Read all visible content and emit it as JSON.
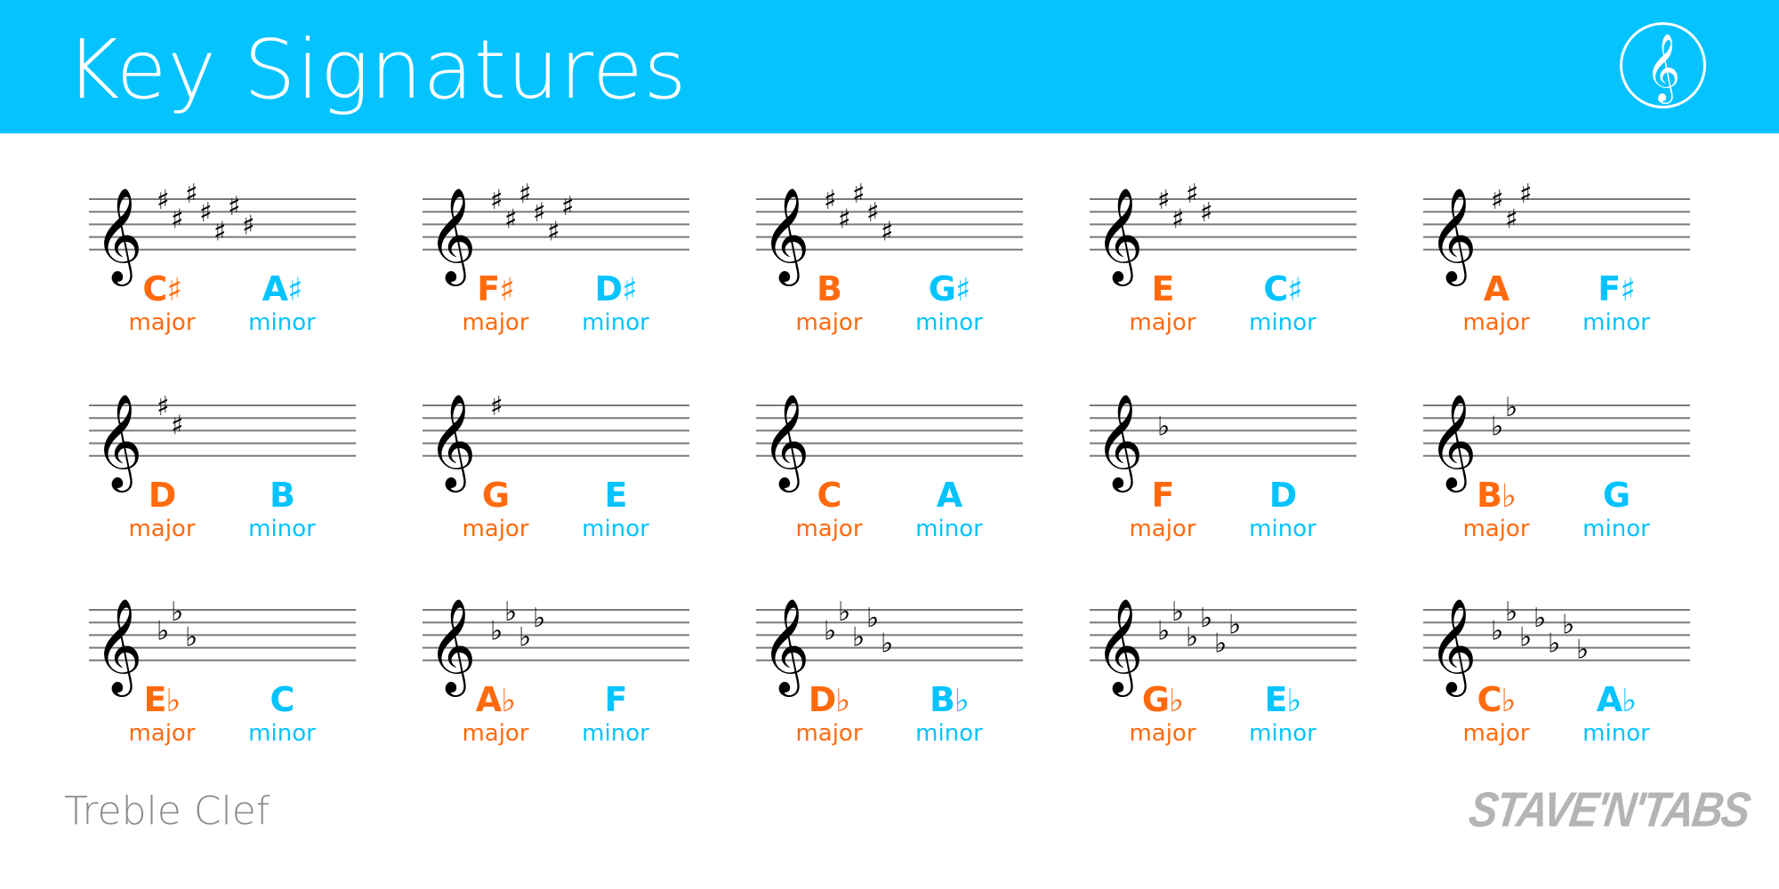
{
  "header": {
    "title": "Key Signatures",
    "logo_icon": "treble-clef-icon",
    "background_color": "#05c3ff"
  },
  "colors": {
    "major": "#ff6a0f",
    "minor": "#05c3ff",
    "staff_lines": "#7a7a7a",
    "glyphs": "#000000"
  },
  "mode_labels": {
    "major": "major",
    "minor": "minor"
  },
  "keys": [
    {
      "major_letter": "C",
      "major_acc": "♯",
      "minor_letter": "A",
      "minor_acc": "♯",
      "type": "sharp",
      "count": 7
    },
    {
      "major_letter": "F",
      "major_acc": "♯",
      "minor_letter": "D",
      "minor_acc": "♯",
      "type": "sharp",
      "count": 6
    },
    {
      "major_letter": "B",
      "major_acc": "",
      "minor_letter": "G",
      "minor_acc": "♯",
      "type": "sharp",
      "count": 5
    },
    {
      "major_letter": "E",
      "major_acc": "",
      "minor_letter": "C",
      "minor_acc": "♯",
      "type": "sharp",
      "count": 4
    },
    {
      "major_letter": "A",
      "major_acc": "",
      "minor_letter": "F",
      "minor_acc": "♯",
      "type": "sharp",
      "count": 3
    },
    {
      "major_letter": "D",
      "major_acc": "",
      "minor_letter": "B",
      "minor_acc": "",
      "type": "sharp",
      "count": 2
    },
    {
      "major_letter": "G",
      "major_acc": "",
      "minor_letter": "E",
      "minor_acc": "",
      "type": "sharp",
      "count": 1
    },
    {
      "major_letter": "C",
      "major_acc": "",
      "minor_letter": "A",
      "minor_acc": "",
      "type": "none",
      "count": 0
    },
    {
      "major_letter": "F",
      "major_acc": "",
      "minor_letter": "D",
      "minor_acc": "",
      "type": "flat",
      "count": 1
    },
    {
      "major_letter": "B",
      "major_acc": "♭",
      "minor_letter": "G",
      "minor_acc": "",
      "type": "flat",
      "count": 2
    },
    {
      "major_letter": "E",
      "major_acc": "♭",
      "minor_letter": "C",
      "minor_acc": "",
      "type": "flat",
      "count": 3
    },
    {
      "major_letter": "A",
      "major_acc": "♭",
      "minor_letter": "F",
      "minor_acc": "",
      "type": "flat",
      "count": 4
    },
    {
      "major_letter": "D",
      "major_acc": "♭",
      "minor_letter": "B",
      "minor_acc": "♭",
      "type": "flat",
      "count": 5
    },
    {
      "major_letter": "G",
      "major_acc": "♭",
      "minor_letter": "E",
      "minor_acc": "♭",
      "type": "flat",
      "count": 6
    },
    {
      "major_letter": "C",
      "major_acc": "♭",
      "minor_letter": "A",
      "minor_acc": "♭",
      "type": "flat",
      "count": 7
    }
  ],
  "sharp_order": [
    "F5",
    "C5",
    "G5",
    "D5",
    "A4",
    "E5",
    "B4"
  ],
  "flat_order": [
    "B4",
    "E5",
    "A4",
    "D5",
    "G4",
    "C5",
    "F4"
  ],
  "footer": {
    "clef_label": "Treble Clef",
    "brand": "STAVE'N'TABS"
  }
}
